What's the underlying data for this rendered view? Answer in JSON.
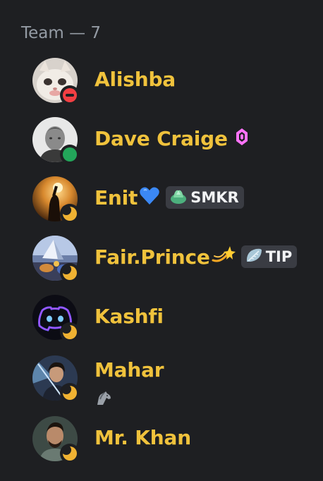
{
  "group": {
    "header": "Team — 7"
  },
  "members": [
    {
      "name": "Alishba",
      "status": "dnd"
    },
    {
      "name": "Dave Craige",
      "status": "online",
      "badge": "boost-gem-icon"
    },
    {
      "name": "Enit",
      "emoji": "blue-heart-icon",
      "status": "idle",
      "tag": "SMKR",
      "tag_icon": "plant-icon"
    },
    {
      "name": "Fair.Prince",
      "emoji": "dizzy-star-icon",
      "status": "idle",
      "tag": "TIP",
      "tag_icon": "leaf-icon"
    },
    {
      "name": "Kashfi",
      "status": "idle"
    },
    {
      "name": "Mahar",
      "status": "idle",
      "activity_icon": "horse-icon"
    },
    {
      "name": "Mr. Khan",
      "status": "idle"
    }
  ],
  "colors": {
    "background": "#1e1f22",
    "header_text": "#949ba4",
    "name": "#f0c23c",
    "status_online": "#23a55a",
    "status_idle": "#f0b232",
    "status_dnd": "#f23f43",
    "tag_bg": "#3a3c43"
  }
}
